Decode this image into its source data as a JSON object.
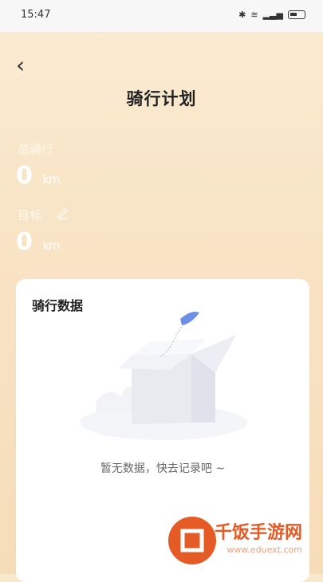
{
  "status": {
    "time": "15:47"
  },
  "header": {
    "title": "骑行计划"
  },
  "summary": {
    "total_label": "总骑行",
    "total_value": "0",
    "total_unit": "km",
    "goal_label": "目标",
    "goal_value": "0",
    "goal_unit": "km"
  },
  "card": {
    "title": "骑行数据",
    "empty_text": "暂无数据，快去记录吧 ~"
  },
  "watermark": {
    "name": "千饭手游网",
    "url": "www.eduext.com"
  },
  "colors": {
    "background_top": "#faecd3",
    "background_bottom": "#f6ddb9",
    "card_bg": "#ffffff",
    "brand_orange": "#e45b25"
  },
  "icons": [
    "chevron-left-icon",
    "pencil-icon",
    "bluetooth-icon",
    "wifi-icon",
    "signal-icon",
    "battery-icon"
  ]
}
